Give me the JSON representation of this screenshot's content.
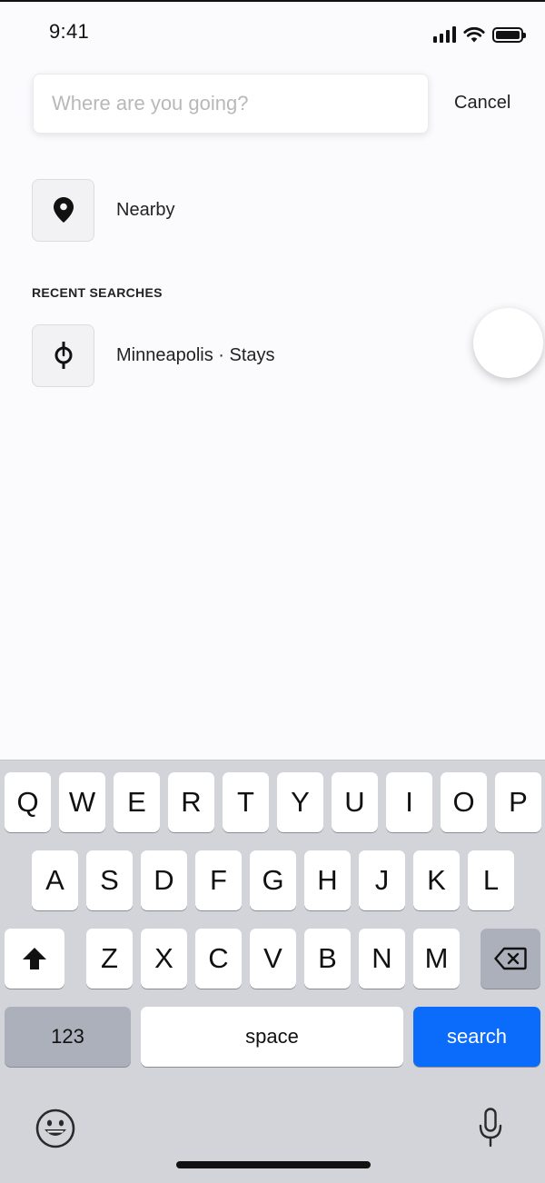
{
  "status_bar": {
    "time": "9:41"
  },
  "search": {
    "placeholder": "Where are you going?",
    "cancel_label": "Cancel"
  },
  "nearby": {
    "label": "Nearby"
  },
  "recent": {
    "title": "RECENT SEARCHES",
    "items": [
      {
        "label": "Minneapolis · Stays"
      }
    ]
  },
  "keyboard": {
    "row1": [
      "Q",
      "W",
      "E",
      "R",
      "T",
      "Y",
      "U",
      "I",
      "O",
      "P"
    ],
    "row2": [
      "A",
      "S",
      "D",
      "F",
      "G",
      "H",
      "J",
      "K",
      "L"
    ],
    "row3": [
      "Z",
      "X",
      "C",
      "V",
      "B",
      "N",
      "M"
    ],
    "numbers_label": "123",
    "space_label": "space",
    "search_label": "search"
  },
  "colors": {
    "accent": "#0b6cfb",
    "background": "#fbfafd",
    "keyboard_bg": "#d2d4da"
  }
}
